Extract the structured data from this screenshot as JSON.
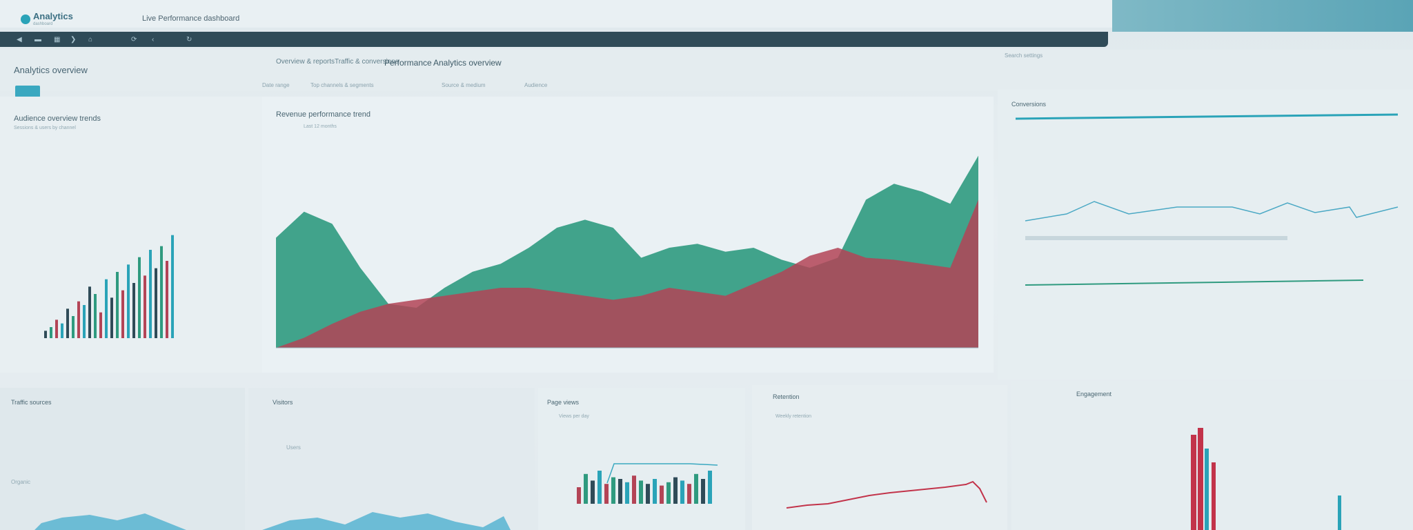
{
  "header": {
    "app_name": "Analytics",
    "app_subtitle": "dashboard",
    "window_title": "Live Performance dashboard"
  },
  "toolbar": {
    "icons": [
      "back-icon",
      "forward-icon",
      "list-icon",
      "chevron-icon",
      "home-icon",
      "refresh-icon",
      "chevron-left-icon",
      "next-icon"
    ]
  },
  "subheader": {
    "dashboard_title": "Analytics overview",
    "tabs": [
      "Overview & reports",
      "Traffic & conversions",
      "Performance",
      "Analytics overview"
    ],
    "filters": [
      "Date range",
      "Top channels & segments",
      "Source & medium",
      "Audience"
    ],
    "search_placeholder": "Search settings"
  },
  "panels": {
    "left_top": {
      "title": "Audience overview trends",
      "subtitle": "Sessions & users by channel"
    },
    "main": {
      "title": "Revenue performance trend",
      "subtitle": "Last 12 months"
    },
    "right_top": {
      "title": "Conversions"
    },
    "bottom": [
      {
        "title": "Traffic sources",
        "subtitle": "Organic"
      },
      {
        "title": "Visitors",
        "subtitle": "Users"
      },
      {
        "title": "Page views",
        "subtitle": "Views per day"
      },
      {
        "title": "Retention",
        "subtitle": "Weekly retention"
      },
      {
        "title": "Engagement",
        "subtitle": ""
      }
    ]
  },
  "colors": {
    "accent": "#2aa3b8",
    "green": "#2f9a7f",
    "red": "#b34456",
    "dark": "#2f4b58"
  },
  "chart_data": [
    {
      "type": "area",
      "x": [
        1,
        2,
        3,
        4,
        5,
        6,
        7,
        8,
        9,
        10,
        11,
        12,
        13,
        14,
        15,
        16,
        17,
        18,
        19,
        20,
        21,
        22,
        23,
        24,
        25,
        26
      ],
      "series": [
        {
          "values": [
            55,
            68,
            62,
            40,
            22,
            20,
            30,
            38,
            42,
            50,
            60,
            64,
            60,
            45,
            50,
            52,
            48,
            50,
            44,
            40,
            45,
            74,
            82,
            78,
            72,
            96
          ]
        },
        {
          "values": [
            0,
            5,
            12,
            18,
            22,
            24,
            26,
            28,
            30,
            30,
            28,
            26,
            24,
            26,
            30,
            28,
            26,
            32,
            38,
            46,
            50,
            45,
            44,
            42,
            40,
            74
          ]
        }
      ]
    },
    {
      "type": "bar",
      "values": [
        2,
        3,
        5,
        4,
        8,
        6,
        10,
        9,
        14,
        12,
        7,
        16,
        11,
        18,
        13,
        20,
        15,
        22,
        17,
        24,
        19,
        25,
        21,
        28
      ]
    }
  ]
}
